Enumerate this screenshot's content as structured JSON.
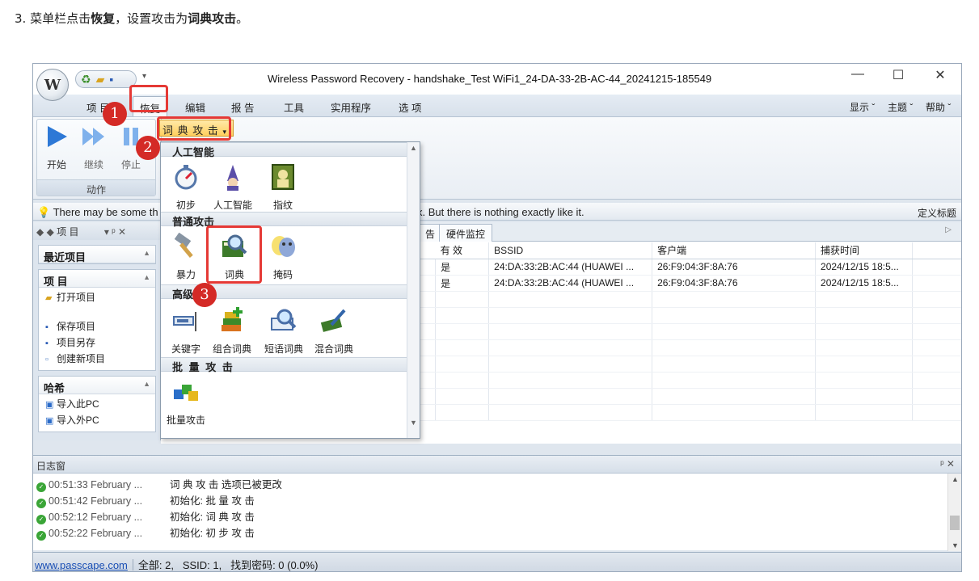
{
  "instruction": {
    "prefix": "3. 菜单栏点击",
    "bold1": "恢复",
    "mid": "，设置攻击为",
    "bold2": "词典攻击",
    "suffix": "。"
  },
  "window": {
    "title": "Wireless Password Recovery - handshake_Test WiFi1_24-DA-33-2B-AC-44_20241215-185549",
    "orb_label": "W",
    "minimize": "—",
    "maximize": "☐",
    "close": "✕"
  },
  "menubar": {
    "tabs": [
      "项 目",
      "恢复",
      "编辑",
      "报 告",
      "工具",
      "实用程序",
      "选 项"
    ],
    "right": [
      "显示",
      "主题",
      "帮助"
    ]
  },
  "ribbon": {
    "start": "开始",
    "continue": "继续",
    "stop": "停止",
    "group_label": "动作",
    "attack_select": "词 典 攻 击"
  },
  "infobar": {
    "text": "There may be some th",
    "text2": "x. But there is nothing exactly like it.",
    "right": "定义标题"
  },
  "leftpane": {
    "header": "项 目",
    "recent": "最近项目",
    "project_group": "项 目",
    "project_items": [
      "打开项目",
      "保存项目",
      "项目另存",
      "创建新项目"
    ],
    "hash_group": "哈希",
    "hash_items": [
      "导入此PC",
      "导入外PC"
    ]
  },
  "grid": {
    "tabs": [
      "告",
      "硬件监控"
    ],
    "columns": [
      "有 效",
      "BSSID",
      "客户端",
      "捕获时间"
    ],
    "rows": [
      [
        "是",
        "24:DA:33:2B:AC:44 (HUAWEI ...",
        "26:F9:04:3F:8A:76",
        "2024/12/15 18:5..."
      ],
      [
        "是",
        "24:DA:33:2B:AC:44 (HUAWEI ...",
        "26:F9:04:3F:8A:76",
        "2024/12/15 18:5..."
      ]
    ]
  },
  "gallery": {
    "sections": [
      "人工智能",
      "普通攻击",
      "高级",
      "批 量 攻 击"
    ],
    "ai_items": [
      "初步",
      "人工智能",
      "指纹"
    ],
    "normal_items": [
      "暴力",
      "词典",
      "掩码"
    ],
    "adv_items": [
      "关键字",
      "组合词典",
      "短语词典",
      "混合词典"
    ],
    "batch_items": [
      "批量攻击"
    ]
  },
  "log": {
    "title": "日志窗",
    "pin": "ᵖ ✕",
    "rows": [
      {
        "time": "00:51:33 February ...",
        "msg": "词 典 攻 击 选项已被更改"
      },
      {
        "time": "00:51:42 February ...",
        "msg": "初始化: 批 量 攻 击"
      },
      {
        "time": "00:52:12 February ...",
        "msg": "初始化: 词 典 攻 击"
      },
      {
        "time": "00:52:22 February ...",
        "msg": "初始化: 初 步 攻 击"
      }
    ]
  },
  "status": {
    "link": "www.passcape.com",
    "total": "全部: 2,",
    "ssid": "SSID: 1,",
    "found": "找到密码: 0 (0.0%)"
  },
  "badges": [
    "1",
    "2",
    "3"
  ],
  "colors": {
    "callout": "#e53935",
    "badge": "#d42a26",
    "accent": "#ffcf5e"
  }
}
